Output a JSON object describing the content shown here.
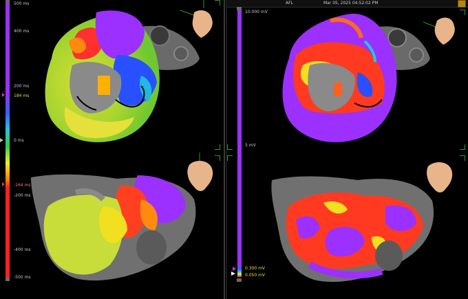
{
  "header": {
    "map_label": "AFL",
    "timestamp": "Mar 05, 2025 04:52:02 PM"
  },
  "left_scale": {
    "kind": "LAT",
    "ticks": [
      "500 ms",
      "400 ms",
      "200 ms",
      "184 ms",
      "0 ms",
      "-164 ms",
      "-200 ms",
      "-400 ms",
      "-500 ms"
    ],
    "upper_marker_value": "184 ms",
    "lower_marker_value": "-164 ms",
    "colors": [
      "#9b30ff",
      "#3060ff",
      "#20c8e0",
      "#30d040",
      "#f0f020",
      "#ff8000",
      "#ff2020"
    ]
  },
  "right_scale": {
    "kind": "Voltage",
    "ticks": [
      "10.000 mV",
      "5 mV",
      "0.300 mV",
      "0.050 mV"
    ],
    "upper_value": "0.300 mV",
    "lower_value": "0.050 mV",
    "colors": [
      "#9b30ff",
      "#3060ff",
      "#20c8e0",
      "#30d040",
      "#f0f020",
      "#ff8000",
      "#ff2020"
    ]
  },
  "views": {
    "left_top": "LAT map - inferior/valvular view",
    "left_bottom": "LAT map - anterior view",
    "right_top": "Voltage map - inferior/valvular view",
    "right_bottom": "Voltage map - anterior view"
  }
}
